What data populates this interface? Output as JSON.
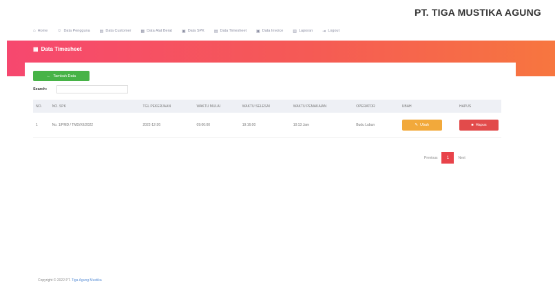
{
  "brand": "PT. TIGA MUSTIKA AGUNG",
  "nav": [
    {
      "icon": "home-icon",
      "glyph": "⌂",
      "label": "Home"
    },
    {
      "icon": "user-icon",
      "glyph": "☺",
      "label": "Data Pengguna"
    },
    {
      "icon": "building-icon",
      "glyph": "▤",
      "label": "Data Customer"
    },
    {
      "icon": "truck-icon",
      "glyph": "▦",
      "label": "Data Alat Berat"
    },
    {
      "icon": "document-icon",
      "glyph": "▣",
      "label": "Data SPK"
    },
    {
      "icon": "calendar-icon",
      "glyph": "▤",
      "label": "Data Timesheet"
    },
    {
      "icon": "invoice-icon",
      "glyph": "▣",
      "label": "Data Invoice"
    },
    {
      "icon": "report-icon",
      "glyph": "▥",
      "label": "Laporan"
    },
    {
      "icon": "logout-icon",
      "glyph": "⇥",
      "label": "Logout"
    }
  ],
  "page": {
    "title": "Data Timesheet",
    "title_icon": "calendar-icon",
    "add_button_label": "Tambah Data",
    "search_label": "Search:",
    "search_value": ""
  },
  "table": {
    "columns": [
      "NO.",
      "NO. SPK",
      "TGL PEKERJAAN",
      "WAKTU MULAI",
      "WAKTU SELESAI",
      "WAKTU PEMAKAIAN",
      "OPERATOR",
      "UBAH",
      "HAPUS"
    ],
    "rows": [
      {
        "no": "1",
        "no_spk": "No. 1/PMD / TMD/XII/2022",
        "tgl_pekerjaan": "2022-12-26",
        "waktu_mulai": "09:00:00",
        "waktu_selesai": "19:16:00",
        "waktu_pemakaian": "10:13 Jam",
        "operator": "Budu Lubun",
        "edit_label": "Ubah",
        "delete_label": "Hapus"
      }
    ]
  },
  "pagination": {
    "previous": "Previous",
    "current": "1",
    "next": "Next"
  },
  "footer": {
    "text": "Copyright © 2022 PT.",
    "link": "Tiga Agung Mustika"
  },
  "colors": {
    "banner_start": "#f6486f",
    "banner_end": "#f7763f",
    "add_button": "#47b347",
    "edit_button": "#f2a93b",
    "delete_button": "#e24b4b"
  }
}
